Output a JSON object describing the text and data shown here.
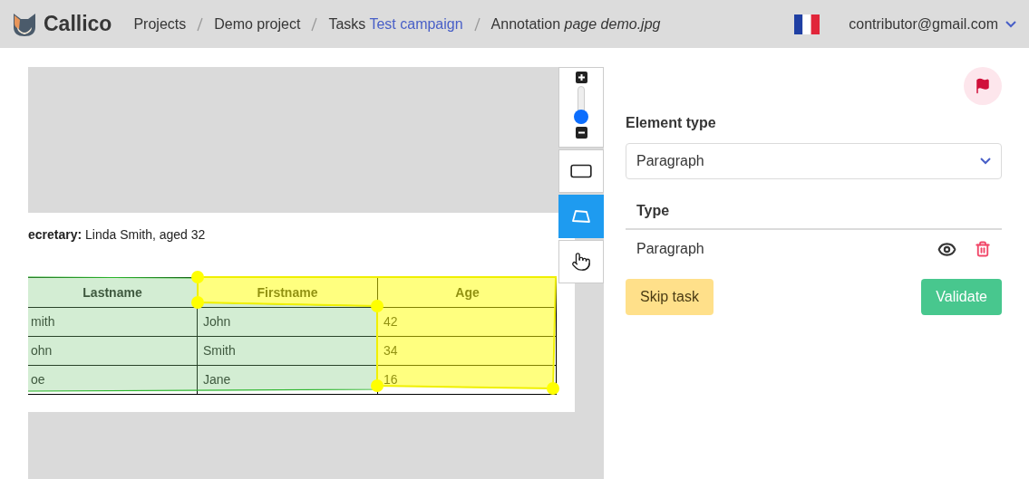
{
  "header": {
    "brand": "Callico",
    "breadcrumbs": [
      {
        "label": "Projects"
      },
      {
        "label": "Demo project"
      },
      {
        "label": "Tasks",
        "link": "Test campaign"
      },
      {
        "label": "Annotation *page demo.jpg*"
      }
    ],
    "user": "contributor@gmail.com"
  },
  "viewer": {
    "zoom": {
      "level": 0.2
    },
    "tools": [
      {
        "kind": "rectangle",
        "selected": false
      },
      {
        "kind": "polygon",
        "selected": true
      },
      {
        "kind": "pan",
        "selected": false
      }
    ],
    "document": {
      "caption": "**ecretary:** Linda Smith, aged 32",
      "columns": [
        "Lastname",
        "Firstname",
        "Age"
      ],
      "rows": [
        [
          "mith",
          "John",
          "42"
        ],
        [
          "ohn",
          "Smith",
          "34"
        ],
        [
          "oe",
          "Jane",
          "16"
        ]
      ]
    }
  },
  "panel": {
    "element_type_label": "Element type",
    "element_type": "Paragraph",
    "table": {
      "column": "Type",
      "rows": [
        {
          "type": "Paragraph"
        }
      ]
    },
    "buttons": [
      {
        "kind": "skip",
        "label": "Skip task"
      },
      {
        "kind": "validate",
        "label": "Validate"
      }
    ]
  }
}
